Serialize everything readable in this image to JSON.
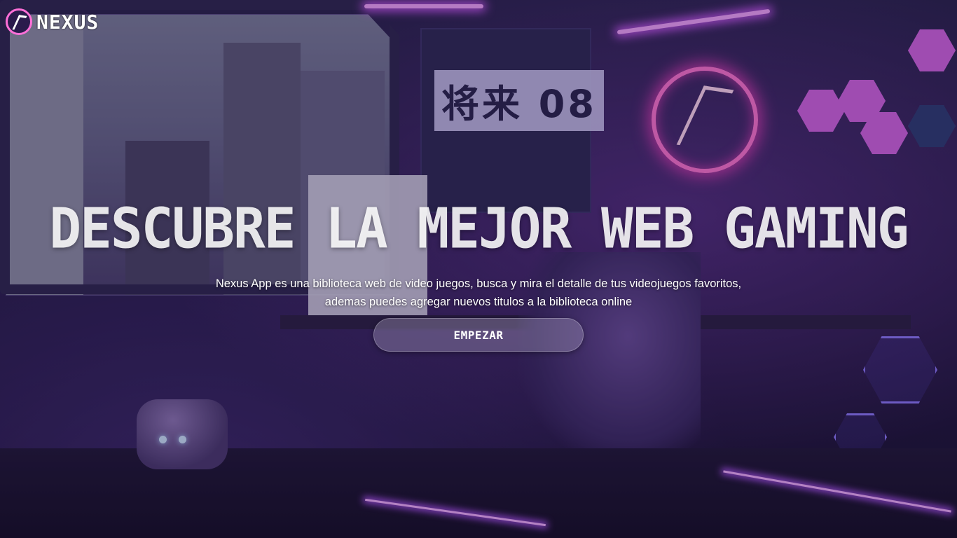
{
  "header": {
    "brand_name": "NEXUS",
    "brand_icon": "nexus-logo-icon",
    "accent_color": "#ff6fd8"
  },
  "hero": {
    "title": "DESCUBRE LA MEJOR WEB GAMING",
    "description_line1": "Nexus App es una biblioteca web de video juegos, busca y mira el detalle de tus videojuegos favoritos,",
    "description_line2": "ademas puedes agregar nuevos titulos a la biblioteca online",
    "cta_label": "EMPEZAR"
  },
  "background": {
    "kanji_sign": "将来 08"
  }
}
